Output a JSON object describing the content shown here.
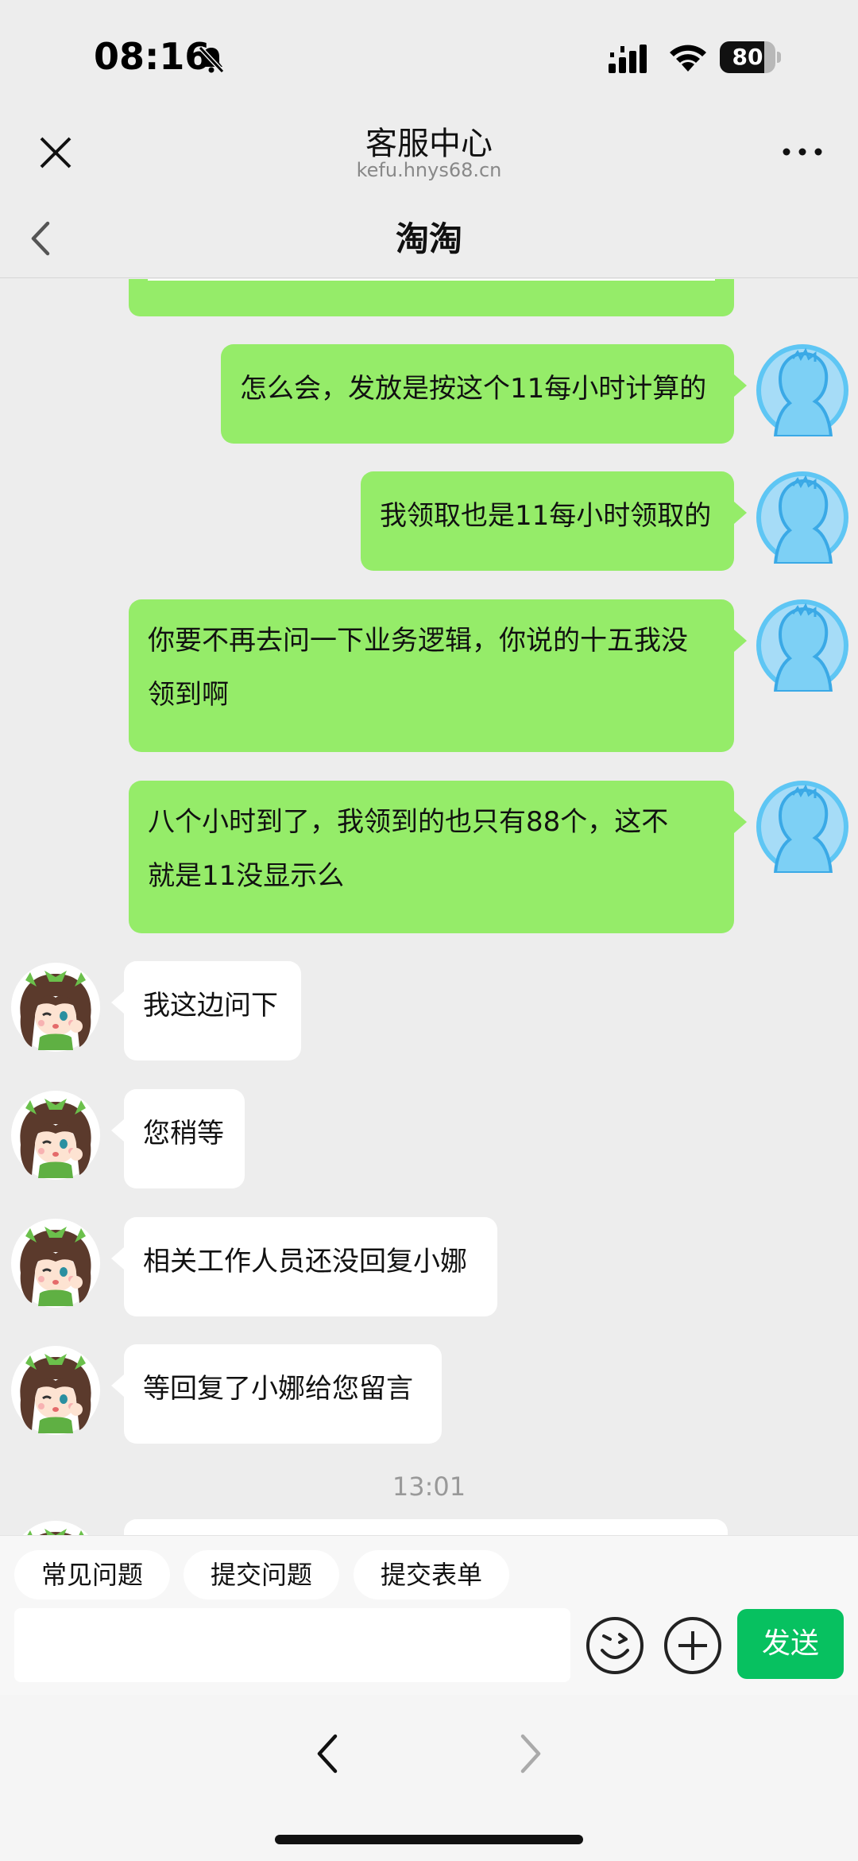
{
  "status_bar": {
    "time": "08:16",
    "battery_level": "80",
    "battery_fraction": 0.8
  },
  "browser": {
    "title": "客服中心",
    "url": "kefu.hnys68.cn"
  },
  "chat": {
    "title": "淘淘"
  },
  "messages": [
    {
      "from": "user",
      "text": "怎么会，发放是按这个11每小时计算的"
    },
    {
      "from": "user",
      "text": "我领取也是11每小时领取的"
    },
    {
      "from": "user",
      "lines": [
        "你要不再去问一下业务逻辑，你说的十五我没",
        "领到啊"
      ]
    },
    {
      "from": "user",
      "lines": [
        "八个小时到了，我领到的也只有88个，这不",
        "就是11没显示么"
      ]
    },
    {
      "from": "agent",
      "text": "我这边问下"
    },
    {
      "from": "agent",
      "text": "您稍等"
    },
    {
      "from": "agent",
      "text": "相关工作人员还没回复小娜"
    },
    {
      "from": "agent",
      "text": "等回复了小娜给您留言"
    }
  ],
  "timestamp": "13:01",
  "quick_actions": [
    "常见问题",
    "提交问题",
    "提交表单"
  ],
  "composer": {
    "input_value": "",
    "send_label": "发送"
  },
  "colors": {
    "outgoing_bubble": "#95ec69",
    "incoming_bubble": "#ffffff",
    "send_button": "#07c160",
    "background": "#ededed"
  },
  "icons": {
    "status": [
      "bell-slash-icon",
      "cellular-signal-icon",
      "wifi-icon",
      "battery-icon"
    ],
    "header": [
      "close-icon",
      "more-icon",
      "back-chevron-icon"
    ],
    "composer": [
      "emoji-icon",
      "plus-icon"
    ],
    "nav": [
      "nav-back-icon",
      "nav-forward-icon"
    ]
  }
}
